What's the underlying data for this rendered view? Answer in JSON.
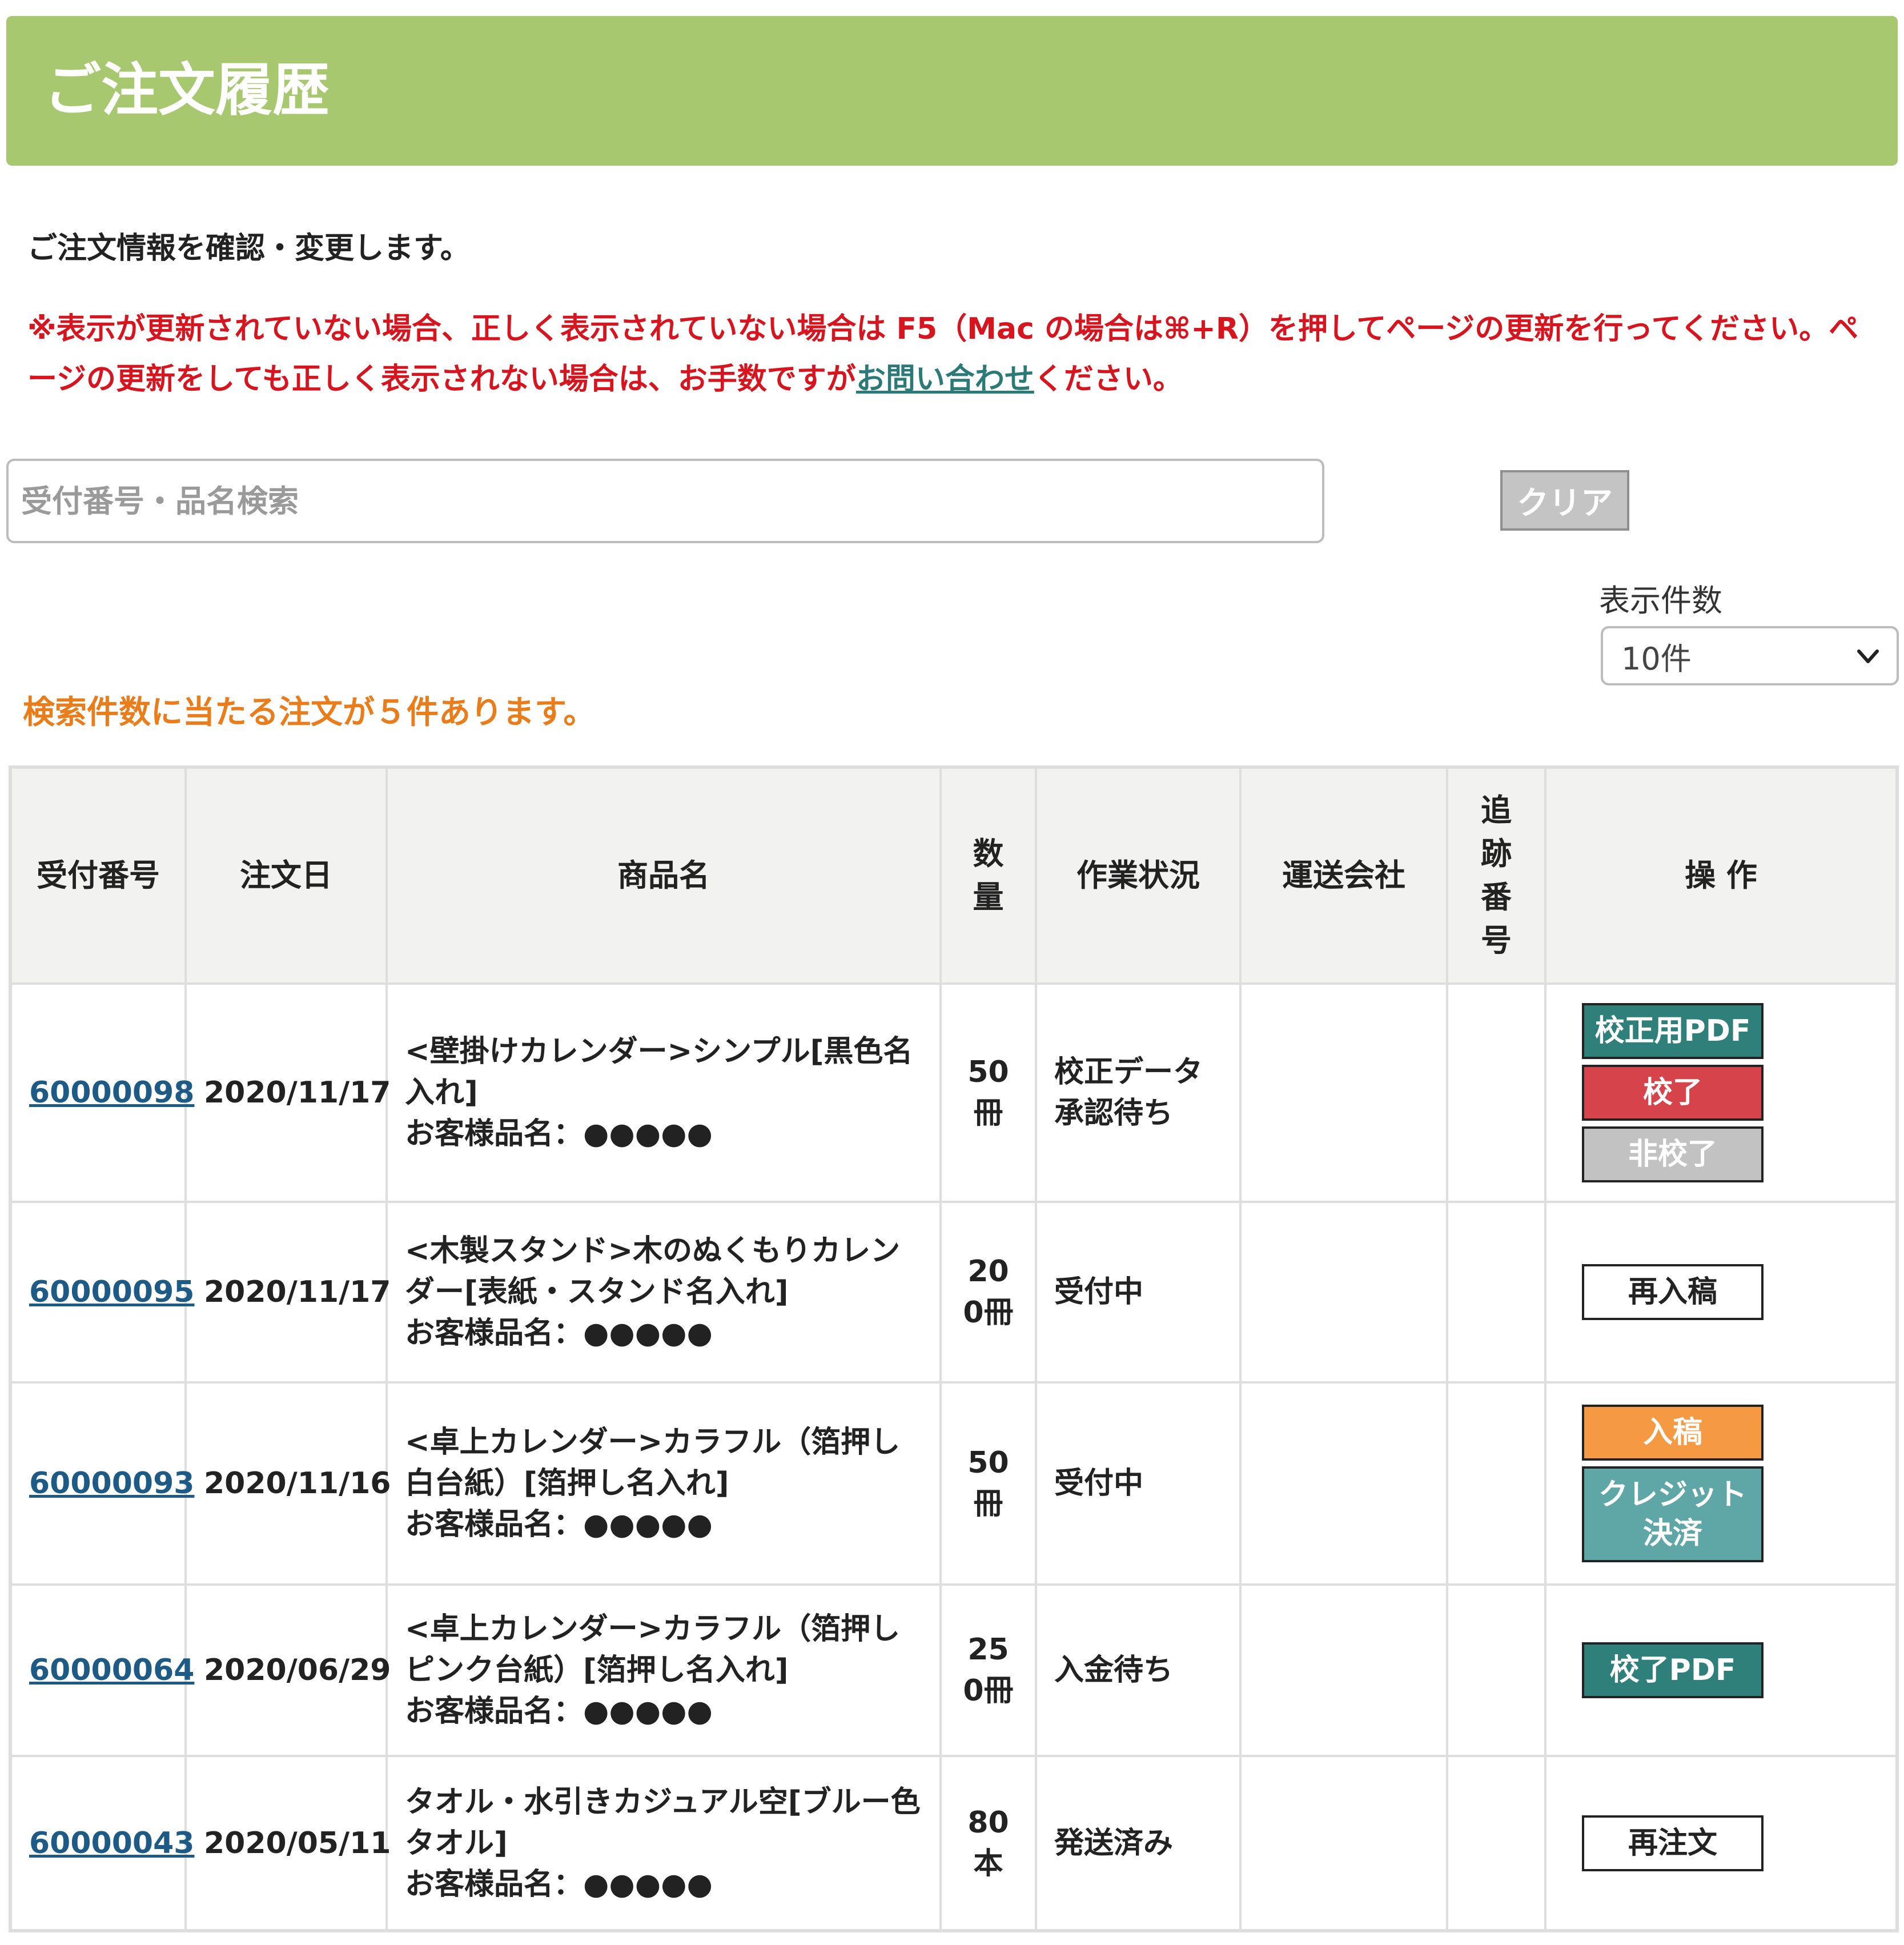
{
  "header": {
    "title": "ご注文履歴"
  },
  "intro": "ご注文情報を確認・変更します。",
  "notice": {
    "text_before": "※表示が更新されていない場合、正しく表示されていない場合は F5（Mac の場合は⌘+R）を押してページの更新を行ってください。ページの更新をしても正しく表示されない場合は、お手数ですが",
    "link_label": "お問い合わせ",
    "text_after": "ください。"
  },
  "search": {
    "placeholder": "受付番号・品名検索",
    "value": "",
    "clear_label": "クリア"
  },
  "page_size": {
    "label": "表示件数",
    "selected": "10件"
  },
  "result_count_text": "検索件数に当たる注文が５件あります。",
  "table": {
    "headers": {
      "order_no": "受付番号",
      "order_date": "注文日",
      "product": "商品名",
      "quantity": "数量",
      "status": "作業状況",
      "carrier": "運送会社",
      "tracking": "追跡番号",
      "actions": "操 作"
    },
    "rows": [
      {
        "order_no": "60000098",
        "date": "2020/11/17",
        "product": "<壁掛けカレンダー>シンプル[黒色名入れ]",
        "customer_name": "お客様品名：●●●●●",
        "qty": "50冊",
        "status": "校正データ承認待ち",
        "carrier": "",
        "tracking": "",
        "buttons": [
          {
            "label": "校正用PDF",
            "color": "#2f7f7a"
          },
          {
            "label": "校了",
            "color": "#d6434a"
          },
          {
            "label": "非校了",
            "color": "#c2c2c2"
          }
        ]
      },
      {
        "order_no": "60000095",
        "date": "2020/11/17",
        "product": "<木製スタンド>木のぬくもりカレンダー[表紙・スタンド名入れ]",
        "customer_name": "お客様品名：●●●●●",
        "qty": "200冊",
        "status": "受付中",
        "carrier": "",
        "tracking": "",
        "buttons": [
          {
            "label": "再入稿",
            "color": "#ffffff"
          }
        ]
      },
      {
        "order_no": "60000093",
        "date": "2020/11/16",
        "product": "<卓上カレンダー>カラフル（箔押し白台紙）[箔押し名入れ]",
        "customer_name": "お客様品名：●●●●●",
        "qty": "50冊",
        "status": "受付中",
        "carrier": "",
        "tracking": "",
        "buttons": [
          {
            "label": "入稿",
            "color": "#f59a42"
          },
          {
            "label": "クレジット決済",
            "color": "#5fa7a7"
          }
        ]
      },
      {
        "order_no": "60000064",
        "date": "2020/06/29",
        "product": "<卓上カレンダー>カラフル（箔押しピンク台紙）[箔押し名入れ]",
        "customer_name": "お客様品名：●●●●●",
        "qty": "250冊",
        "status": "入金待ち",
        "carrier": "",
        "tracking": "",
        "buttons": [
          {
            "label": "校了PDF",
            "color": "#2f7f7a"
          }
        ]
      },
      {
        "order_no": "60000043",
        "date": "2020/05/11",
        "product": "タオル・水引きカジュアル空[ブルー色タオル]",
        "customer_name": "お客様品名：●●●●●",
        "qty": "80本",
        "status": "発送済み",
        "carrier": "",
        "tracking": "",
        "buttons": [
          {
            "label": "再注文",
            "color": "#ffffff"
          }
        ]
      }
    ]
  }
}
